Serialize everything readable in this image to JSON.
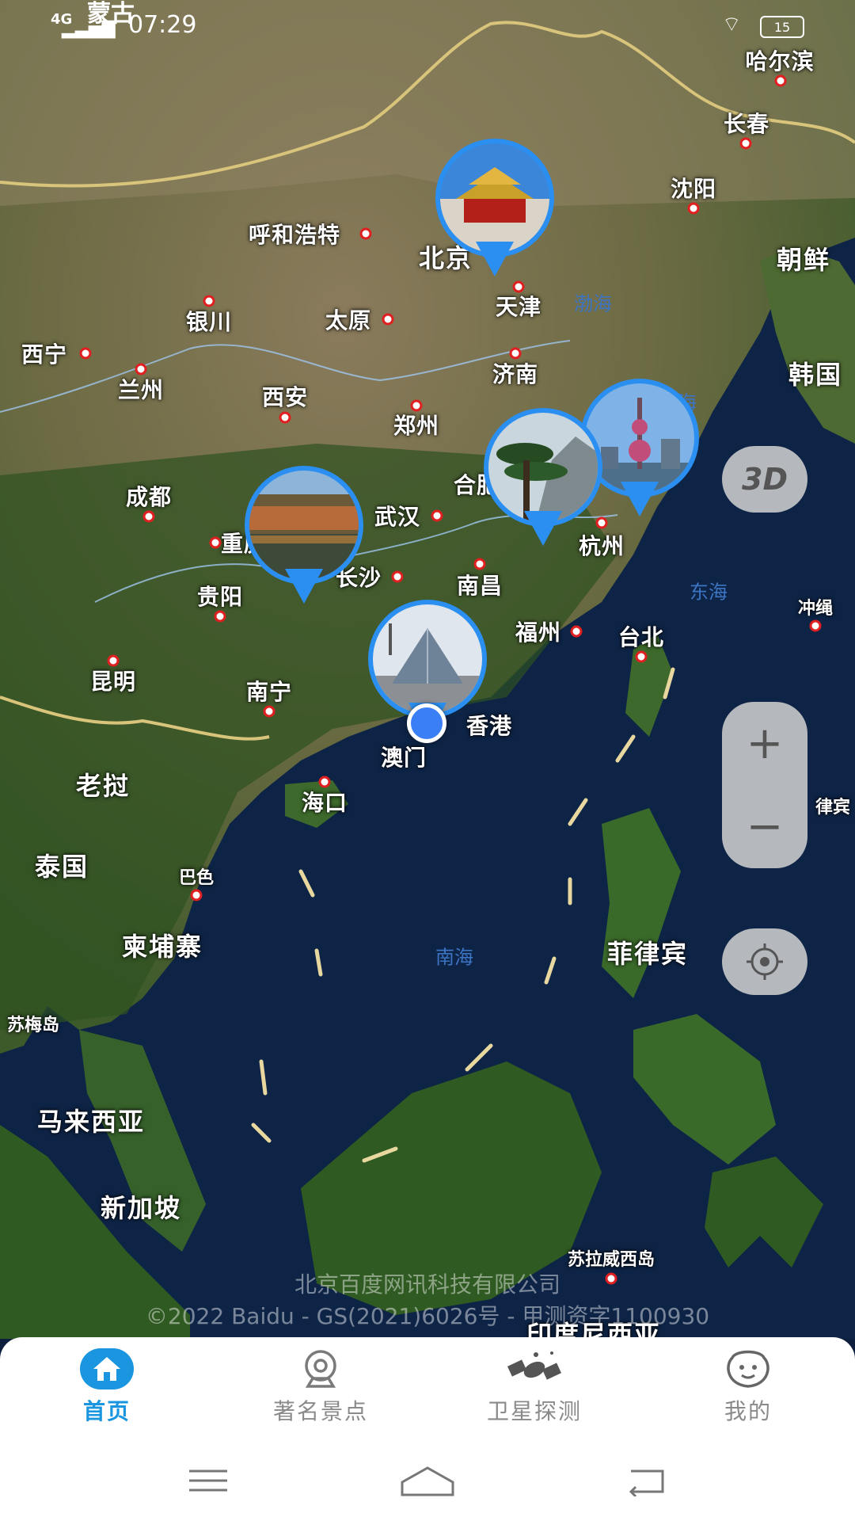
{
  "status": {
    "network": "4G",
    "time": "07:29",
    "battery": "15",
    "partial_label": "蒙古"
  },
  "cities": [
    {
      "name": "哈尔滨",
      "dot": true
    },
    {
      "name": "长春",
      "dot": true
    },
    {
      "name": "沈阳",
      "dot": true
    },
    {
      "name": "朝鲜",
      "dot": false
    },
    {
      "name": "北京",
      "dot": false
    },
    {
      "name": "呼和浩特",
      "dot": true
    },
    {
      "name": "天津",
      "dot": true
    },
    {
      "name": "银川",
      "dot": true
    },
    {
      "name": "太原",
      "dot": true
    },
    {
      "name": "西宁",
      "dot": true
    },
    {
      "name": "兰州",
      "dot": true
    },
    {
      "name": "西安",
      "dot": true
    },
    {
      "name": "济南",
      "dot": true
    },
    {
      "name": "郑州",
      "dot": true
    },
    {
      "name": "韩国",
      "dot": false
    },
    {
      "name": "成都",
      "dot": true
    },
    {
      "name": "武汉",
      "dot": true
    },
    {
      "name": "合肥",
      "dot": false
    },
    {
      "name": "重庆",
      "dot": true
    },
    {
      "name": "长沙",
      "dot": true
    },
    {
      "name": "杭州",
      "dot": true
    },
    {
      "name": "贵阳",
      "dot": true
    },
    {
      "name": "南昌",
      "dot": true
    },
    {
      "name": "福州",
      "dot": true
    },
    {
      "name": "台北",
      "dot": true
    },
    {
      "name": "冲绳",
      "dot": true
    },
    {
      "name": "昆明",
      "dot": true
    },
    {
      "name": "南宁",
      "dot": true
    },
    {
      "name": "香港",
      "dot": false
    },
    {
      "name": "澳门",
      "dot": false
    },
    {
      "name": "老挝",
      "dot": false
    },
    {
      "name": "海口",
      "dot": true
    },
    {
      "name": "律宾",
      "dot": false
    },
    {
      "name": "泰国",
      "dot": false
    },
    {
      "name": "巴色",
      "dot": true
    },
    {
      "name": "柬埔寨",
      "dot": false
    },
    {
      "name": "菲律宾",
      "dot": false
    },
    {
      "name": "苏梅岛",
      "dot": false
    },
    {
      "name": "马来西亚",
      "dot": false
    },
    {
      "name": "新加坡",
      "dot": false
    },
    {
      "name": "苏拉威西岛",
      "dot": true
    },
    {
      "name": "印度尼西亚",
      "dot": false
    }
  ],
  "seas": [
    "渤海",
    "东海",
    "南海",
    "海"
  ],
  "pins": [
    {
      "name": "pin-beijing",
      "photo": "forbidden-city"
    },
    {
      "name": "pin-shanghai",
      "photo": "oriental-pearl-tower"
    },
    {
      "name": "pin-huangshan",
      "photo": "huangshan-pine"
    },
    {
      "name": "pin-fenghuang",
      "photo": "fenghuang-ancient-town"
    },
    {
      "name": "pin-louvre",
      "photo": "louvre-pyramid"
    }
  ],
  "controls": {
    "three_d": "3D",
    "zoom_in": "+",
    "zoom_out": "−"
  },
  "copyright": {
    "line1": "北京百度网讯科技有限公司",
    "line2": "©2022 Baidu - GS(2021)6026号 - 甲测资字1100930"
  },
  "nav": {
    "items": [
      {
        "label": "首页",
        "icon": "home-icon",
        "active": true
      },
      {
        "label": "著名景点",
        "icon": "webcam-icon",
        "active": false
      },
      {
        "label": "卫星探测",
        "icon": "satellite-icon",
        "active": false
      },
      {
        "label": "我的",
        "icon": "smiley-icon",
        "active": false
      }
    ]
  },
  "colors": {
    "accent": "#1a95e0",
    "pin": "#2a8ff0",
    "location": "#3a7ff5"
  }
}
